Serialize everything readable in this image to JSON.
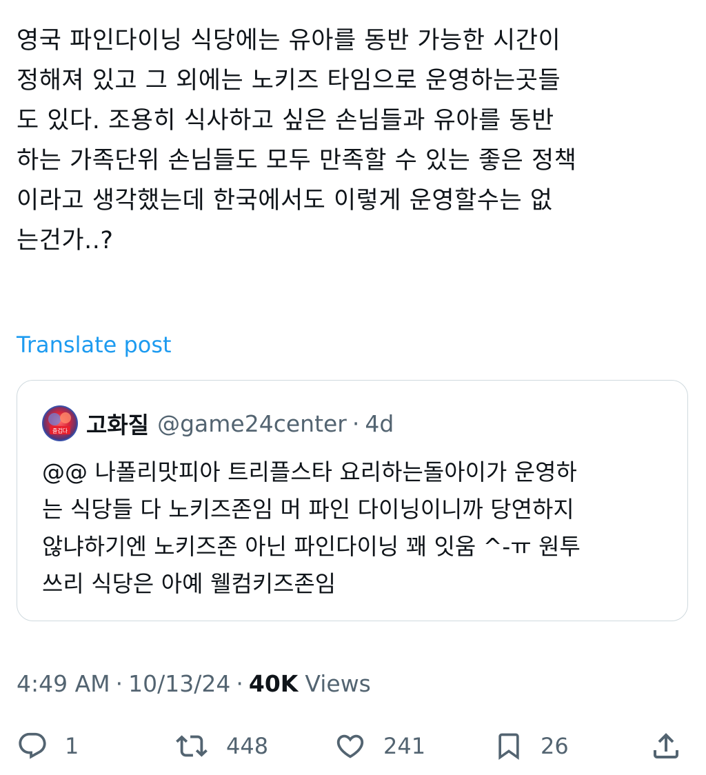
{
  "tweet": {
    "lines": [
      "영국 파인다이닝 식당에는 유아를 동반 가능한 시간이",
      "정해져 있고 그 외에는 노키즈 타임으로 운영하는곳들",
      "도 있다. 조용히 식사하고 싶은 손님들과 유아를 동반",
      "하는 가족단위 손님들도 모두 만족할 수 있는 좋은 정책",
      "이라고 생각했는데 한국에서도 이렇게 운영할수는 없",
      "는건가..?"
    ],
    "translate_label": "Translate post"
  },
  "quote": {
    "avatar_badge": "즐겁다",
    "name": "고화질",
    "handle": "@game24center",
    "separator": "·",
    "time": "4d",
    "lines": [
      "@@ 나폴리맛피아 트리플스타 요리하는돌아이가 운영하",
      "는 식당들 다 노키즈존임 머 파인 다이닝이니까 당연하지",
      "않냐하기엔 노키즈존 아닌 파인다이닝 꽤 잇움 ^-ㅠ 원투",
      "쓰리 식당은 아예 웰컴키즈존임"
    ]
  },
  "meta": {
    "time": "4:49 AM",
    "separator": "·",
    "date": "10/13/24",
    "views_count": "40K",
    "views_label": "Views"
  },
  "actions": {
    "reply": {
      "icon": "reply-icon",
      "count": "1"
    },
    "repost": {
      "icon": "repost-icon",
      "count": "448"
    },
    "like": {
      "icon": "heart-icon",
      "count": "241"
    },
    "bookmark": {
      "icon": "bookmark-icon",
      "count": "26"
    },
    "share": {
      "icon": "share-icon"
    }
  },
  "colors": {
    "text": "#0f1419",
    "secondary": "#536471",
    "link": "#1d9bf0",
    "border": "#cfd9de"
  }
}
